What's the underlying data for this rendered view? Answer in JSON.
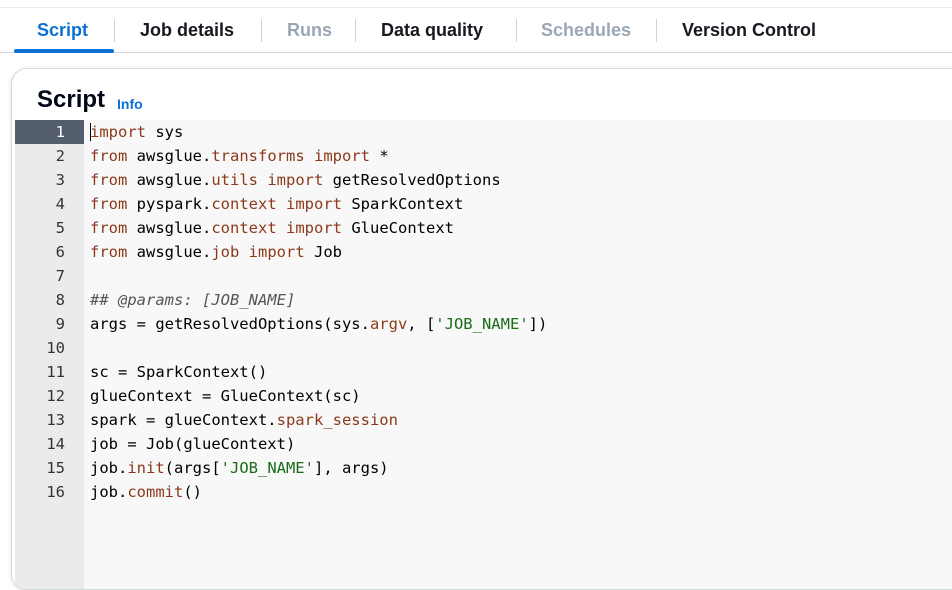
{
  "tabs": [
    {
      "label": "Script",
      "state": "active"
    },
    {
      "label": "Job details",
      "state": "normal"
    },
    {
      "label": "Runs",
      "state": "disabled"
    },
    {
      "label": "Data quality",
      "state": "normal"
    },
    {
      "label": "Schedules",
      "state": "disabled"
    },
    {
      "label": "Version Control",
      "state": "normal"
    }
  ],
  "panel": {
    "title": "Script",
    "info_label": "Info"
  },
  "editor": {
    "active_line": 1,
    "lines": [
      {
        "n": "1",
        "tokens": [
          [
            "kw",
            "import"
          ],
          [
            "",
            " sys"
          ]
        ]
      },
      {
        "n": "2",
        "tokens": [
          [
            "kw",
            "from"
          ],
          [
            "",
            " awsglue."
          ],
          [
            "attr",
            "transforms"
          ],
          [
            "",
            " "
          ],
          [
            "kw",
            "import"
          ],
          [
            "",
            " *"
          ]
        ]
      },
      {
        "n": "3",
        "tokens": [
          [
            "kw",
            "from"
          ],
          [
            "",
            " awsglue."
          ],
          [
            "attr",
            "utils"
          ],
          [
            "",
            " "
          ],
          [
            "kw",
            "import"
          ],
          [
            "",
            " getResolvedOptions"
          ]
        ]
      },
      {
        "n": "4",
        "tokens": [
          [
            "kw",
            "from"
          ],
          [
            "",
            " pyspark."
          ],
          [
            "attr",
            "context"
          ],
          [
            "",
            " "
          ],
          [
            "kw",
            "import"
          ],
          [
            "",
            " SparkContext"
          ]
        ]
      },
      {
        "n": "5",
        "tokens": [
          [
            "kw",
            "from"
          ],
          [
            "",
            " awsglue."
          ],
          [
            "attr",
            "context"
          ],
          [
            "",
            " "
          ],
          [
            "kw",
            "import"
          ],
          [
            "",
            " GlueContext"
          ]
        ]
      },
      {
        "n": "6",
        "tokens": [
          [
            "kw",
            "from"
          ],
          [
            "",
            " awsglue."
          ],
          [
            "attr",
            "job"
          ],
          [
            "",
            " "
          ],
          [
            "kw",
            "import"
          ],
          [
            "",
            " Job"
          ]
        ]
      },
      {
        "n": "7",
        "tokens": []
      },
      {
        "n": "8",
        "tokens": [
          [
            "cm",
            "## @params: [JOB_NAME]"
          ]
        ]
      },
      {
        "n": "9",
        "tokens": [
          [
            "",
            "args = getResolvedOptions(sys."
          ],
          [
            "attr",
            "argv"
          ],
          [
            "",
            ", ["
          ],
          [
            "str",
            "'JOB_NAME'"
          ],
          [
            "",
            "])"
          ]
        ]
      },
      {
        "n": "10",
        "tokens": []
      },
      {
        "n": "11",
        "tokens": [
          [
            "",
            "sc = SparkContext()"
          ]
        ]
      },
      {
        "n": "12",
        "tokens": [
          [
            "",
            "glueContext = GlueContext(sc)"
          ]
        ]
      },
      {
        "n": "13",
        "tokens": [
          [
            "",
            "spark = glueContext."
          ],
          [
            "attr",
            "spark_session"
          ]
        ]
      },
      {
        "n": "14",
        "tokens": [
          [
            "",
            "job = Job(glueContext)"
          ]
        ]
      },
      {
        "n": "15",
        "tokens": [
          [
            "",
            "job."
          ],
          [
            "attr",
            "init"
          ],
          [
            "",
            "(args["
          ],
          [
            "str",
            "'JOB_NAME'"
          ],
          [
            "",
            "], args)"
          ]
        ]
      },
      {
        "n": "16",
        "tokens": [
          [
            "",
            "job."
          ],
          [
            "attr",
            "commit"
          ],
          [
            "",
            "()"
          ]
        ]
      }
    ]
  }
}
